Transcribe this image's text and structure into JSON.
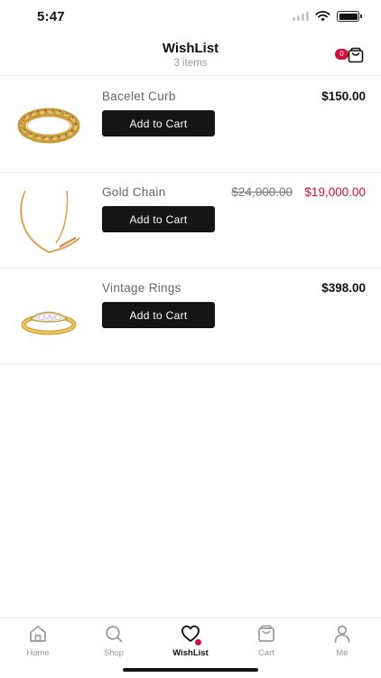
{
  "status_bar": {
    "time": "5:47",
    "icons": [
      "signal-icon",
      "wifi-icon",
      "battery-icon"
    ]
  },
  "header": {
    "title": "WishList",
    "subtitle": "3 items",
    "cart_badge_count": "0"
  },
  "items": [
    {
      "name": "Bacelet Curb",
      "price": "$150.00",
      "button_label": "Add to Cart",
      "image": "bracelet-image"
    },
    {
      "name": "Gold Chain",
      "original_price": "$24,000.00",
      "sale_price": "$19,000.00",
      "button_label": "Add to Cart",
      "image": "chain-image"
    },
    {
      "name": "Vintage Rings",
      "price": "$398.00",
      "button_label": "Add to Cart",
      "image": "ring-image"
    }
  ],
  "tabbar": {
    "tabs": [
      {
        "label": "Home",
        "icon": "home-icon"
      },
      {
        "label": "Shop",
        "icon": "search-icon"
      },
      {
        "label": "WishList",
        "icon": "heart-icon",
        "active": true
      },
      {
        "label": "Cart",
        "icon": "bag-icon"
      },
      {
        "label": "Me",
        "icon": "user-icon"
      }
    ]
  },
  "colors": {
    "accent": "#d0103a",
    "button": "#151515",
    "divider": "#ececec",
    "muted": "#999999"
  }
}
